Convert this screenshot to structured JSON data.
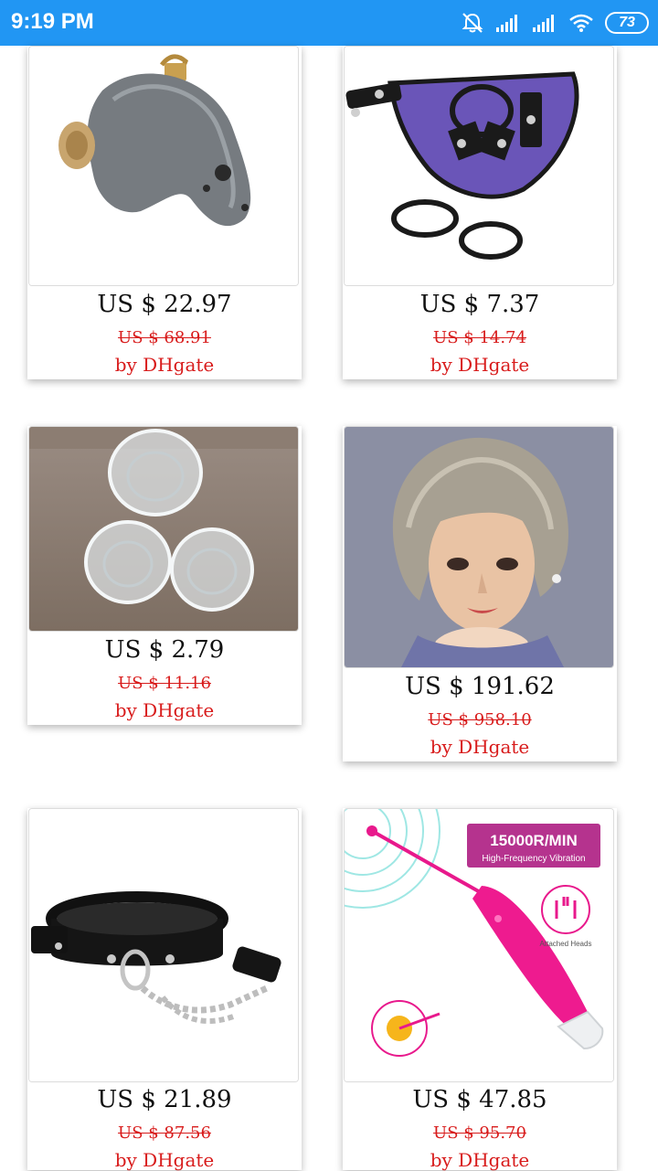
{
  "status_bar": {
    "time": "9:19 PM",
    "battery": "73",
    "icons": [
      "notifications-off-icon",
      "signal-icon",
      "signal-icon",
      "wifi-icon",
      "battery-icon"
    ]
  },
  "products": [
    {
      "price": "US $ 22.97",
      "original_price": "US $ 68.91",
      "seller": "by DHgate",
      "image": "gray-cage-with-padlock"
    },
    {
      "price": "US $ 7.37",
      "original_price": "US $ 14.74",
      "seller": "by DHgate",
      "image": "purple-harness-with-rings"
    },
    {
      "price": "US $ 2.79",
      "original_price": "US $ 11.16",
      "seller": "by DHgate",
      "image": "three-clear-cups"
    },
    {
      "price": "US $ 191.62",
      "original_price": "US $ 958.10",
      "seller": "by DHgate",
      "image": "doll-head-short-hair"
    },
    {
      "price": "US $ 21.89",
      "original_price": "US $ 87.56",
      "seller": "by DHgate",
      "image": "black-collar-with-chain"
    },
    {
      "price": "US $ 47.85",
      "original_price": "US $ 95.70",
      "seller": "by DHgate",
      "image": "pink-vibrator",
      "image_text": {
        "badge_title": "15000R/MIN",
        "badge_subtitle": "High-Frequency Vibration",
        "heads_caption": "Attached Heads"
      }
    }
  ],
  "colors": {
    "status_bar": "#2196f3",
    "price_red": "#d81b1b"
  }
}
